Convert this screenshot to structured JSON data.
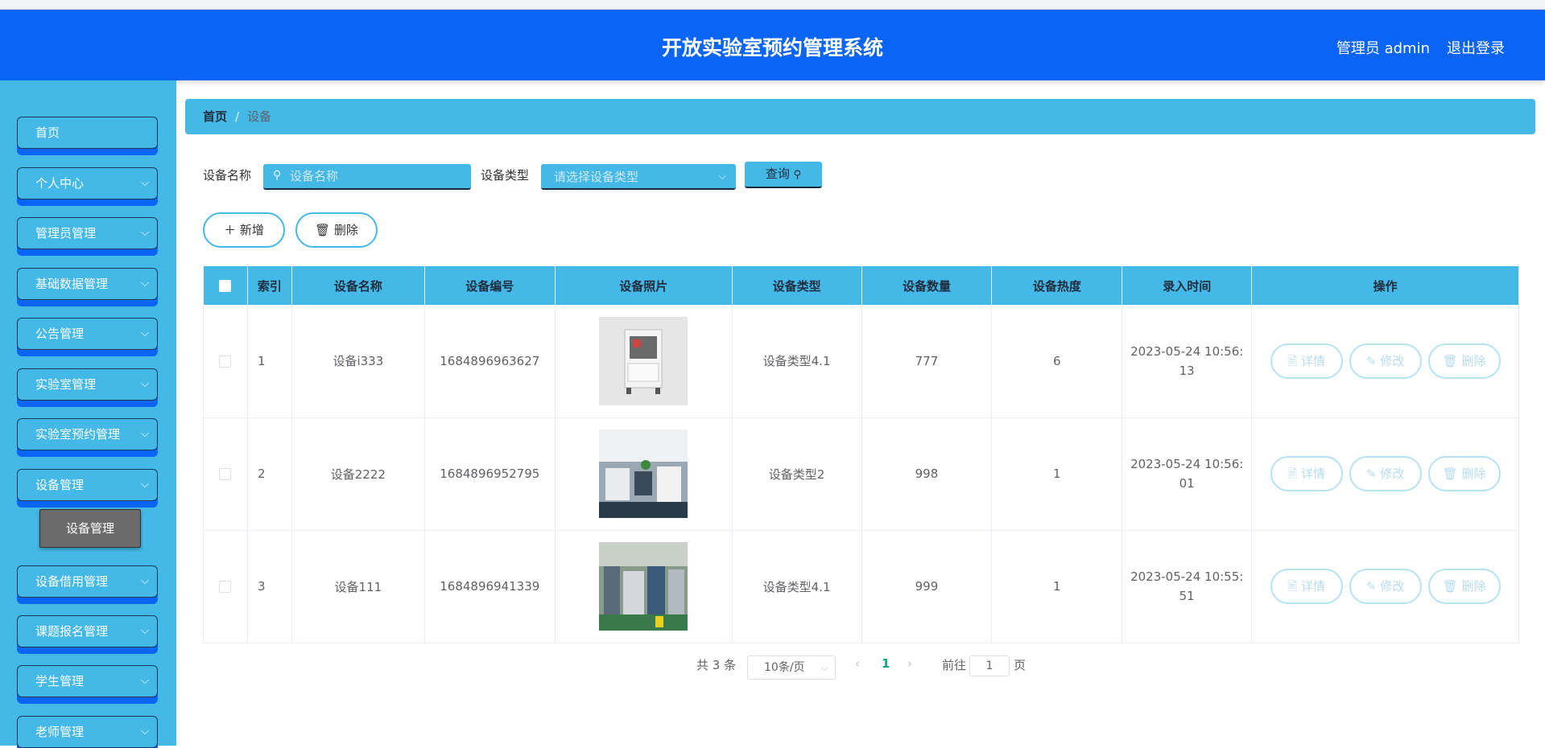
{
  "header": {
    "title": "开放实验室预约管理系统",
    "user": "管理员 admin",
    "logout": "退出登录"
  },
  "sidebar": {
    "items": [
      {
        "label": "首页",
        "has_arrow": false
      },
      {
        "label": "个人中心",
        "has_arrow": true
      },
      {
        "label": "管理员管理",
        "has_arrow": true
      },
      {
        "label": "基础数据管理",
        "has_arrow": true
      },
      {
        "label": "公告管理",
        "has_arrow": true
      },
      {
        "label": "实验室管理",
        "has_arrow": true
      },
      {
        "label": "实验室预约管理",
        "has_arrow": true
      },
      {
        "label": "设备管理",
        "has_arrow": true
      },
      {
        "label": "设备借用管理",
        "has_arrow": true
      },
      {
        "label": "课题报名管理",
        "has_arrow": true
      },
      {
        "label": "学生管理",
        "has_arrow": true
      },
      {
        "label": "老师管理",
        "has_arrow": true
      }
    ],
    "submenu": {
      "label": "设备管理"
    }
  },
  "breadcrumb": {
    "home": "首页",
    "separator": "/",
    "current": "设备"
  },
  "search": {
    "name_label": "设备名称",
    "name_placeholder": "设备名称",
    "type_label": "设备类型",
    "type_placeholder": "请选择设备类型",
    "query_button": "查询"
  },
  "actions": {
    "add": "新增",
    "delete": "删除"
  },
  "table": {
    "headers": [
      "索引",
      "设备名称",
      "设备编号",
      "设备照片",
      "设备类型",
      "设备数量",
      "设备热度",
      "录入时间",
      "操作"
    ],
    "rows": [
      {
        "index": "1",
        "name": "设备i333",
        "code": "1684896963627",
        "type": "设备类型4.1",
        "qty": "777",
        "heat": "6",
        "time_a": "2023-05-24 10:56:",
        "time_b": "13",
        "photo": "white-machine"
      },
      {
        "index": "2",
        "name": "设备2222",
        "code": "1684896952795",
        "type": "设备类型2",
        "qty": "998",
        "heat": "1",
        "time_a": "2023-05-24 10:56:",
        "time_b": "01",
        "photo": "lab-room"
      },
      {
        "index": "3",
        "name": "设备111",
        "code": "1684896941339",
        "type": "设备类型4.1",
        "qty": "999",
        "heat": "1",
        "time_a": "2023-05-24 10:55:",
        "time_b": "51",
        "photo": "factory-line"
      }
    ],
    "ops": {
      "detail": "详情",
      "edit": "修改",
      "delete": "删除"
    }
  },
  "pagination": {
    "total": "共 3 条",
    "page_size": "10条/页",
    "current_page": "1",
    "goto_label": "前往",
    "goto_value": "1",
    "page_suffix": "页"
  },
  "colors": {
    "header_bg": "#0a64f5",
    "sidebar_bg": "#44b8e6",
    "accent": "#44b8e6",
    "submenu_bg": "#6b6b6b"
  }
}
